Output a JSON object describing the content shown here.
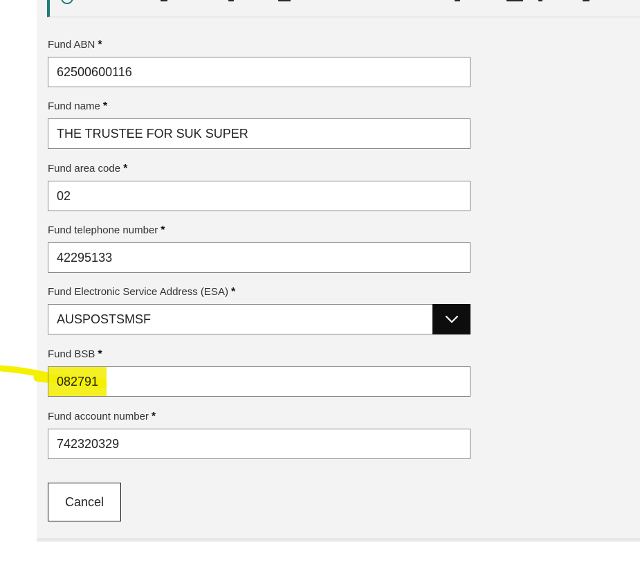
{
  "form": {
    "fields": [
      {
        "label": "Fund ABN",
        "required_mark": "*",
        "value": "62500600116"
      },
      {
        "label": "Fund name",
        "required_mark": "*",
        "value": "THE TRUSTEE FOR SUK SUPER"
      },
      {
        "label": "Fund area code",
        "required_mark": "*",
        "value": "02"
      },
      {
        "label": "Fund telephone number",
        "required_mark": "*",
        "value": "42295133"
      },
      {
        "label": "Fund Electronic Service Address (ESA)",
        "required_mark": "*",
        "value": "AUSPOSTSMSF"
      },
      {
        "label": "Fund BSB",
        "required_mark": "*",
        "value": "082791"
      },
      {
        "label": "Fund account number",
        "required_mark": "*",
        "value": "742320329"
      }
    ],
    "cancel_label": "Cancel"
  },
  "icons": {
    "notice": "info-circle-icon",
    "select": "chevron-down-icon"
  },
  "colors": {
    "accent": "#1f7a7a",
    "highlight": "#f5f000",
    "dropdown_button": "#0d0d0d",
    "panel_bg": "#f3f3f3"
  }
}
